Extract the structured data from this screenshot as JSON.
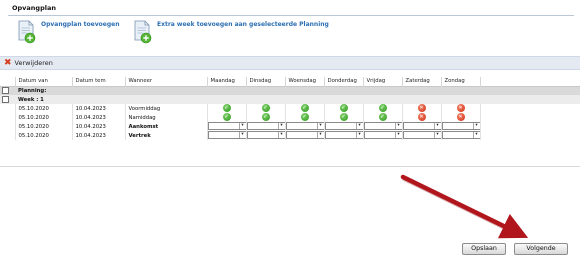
{
  "page": {
    "section_title": "Opvangplan"
  },
  "actions": {
    "add_plan": "Opvangplan toevoegen",
    "extra_week": "Extra week toevoegen aan geselecteerde Planning"
  },
  "toolbar": {
    "delete_label": "Verwijderen"
  },
  "table": {
    "columns": [
      "Datum van",
      "Datum tem",
      "Wanneer",
      "Maandag",
      "Dinsdag",
      "Woensdag",
      "Donderdag",
      "Vrijdag",
      "Zaterdag",
      "Zondag"
    ],
    "group_planning": "Planning:",
    "group_week": "Week : 1",
    "rows": [
      {
        "from": "05.10.2020",
        "to": "10.04.2023",
        "when": "Voormiddag",
        "days": [
          "ok",
          "ok",
          "ok",
          "ok",
          "ok",
          "no",
          "no"
        ]
      },
      {
        "from": "05.10.2020",
        "to": "10.04.2023",
        "when": "Namiddag",
        "days": [
          "ok",
          "ok",
          "ok",
          "ok",
          "ok",
          "no",
          "no"
        ]
      },
      {
        "from": "05.10.2020",
        "to": "10.04.2023",
        "when": "Aankomst",
        "days": [
          "dd",
          "dd",
          "dd",
          "dd",
          "dd",
          "dd",
          "dd"
        ]
      },
      {
        "from": "05.10.2020",
        "to": "10.04.2023",
        "when": "Vertrek",
        "days": [
          "dd",
          "dd",
          "dd",
          "dd",
          "dd",
          "dd",
          "dd"
        ]
      }
    ]
  },
  "buttons": {
    "save": "Opslaan",
    "next": "Volgende"
  },
  "colors": {
    "link": "#2c6fb3",
    "annotation_arrow": "#b0161b",
    "ok": "#2f9a1f",
    "no": "#cf2e12"
  }
}
